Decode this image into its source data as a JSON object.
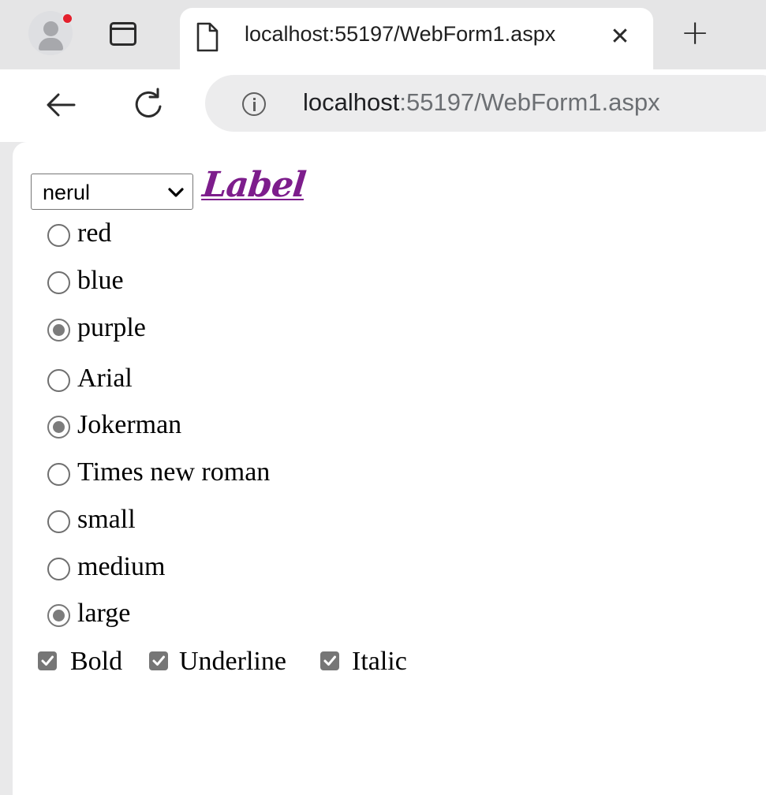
{
  "browser": {
    "tab_title": "localhost:55197/WebForm1.aspx",
    "url_host": "localhost",
    "url_rest": ":55197/WebForm1.aspx"
  },
  "form": {
    "select_value": "nerul",
    "label_text": "Label",
    "label_color": "#7d1d8c",
    "radios": [
      {
        "text": "red",
        "checked": false
      },
      {
        "text": "blue",
        "checked": false
      },
      {
        "text": "purple",
        "checked": true
      },
      {
        "text": "Arial",
        "checked": false
      },
      {
        "text": "Jokerman",
        "checked": true
      },
      {
        "text": "Times new roman",
        "checked": false
      },
      {
        "text": "small",
        "checked": false
      },
      {
        "text": "medium",
        "checked": false
      },
      {
        "text": "large",
        "checked": true
      }
    ],
    "checkboxes": [
      {
        "text": "Bold",
        "checked": true
      },
      {
        "text": "Underline",
        "checked": true
      },
      {
        "text": "Italic",
        "checked": true
      }
    ]
  }
}
